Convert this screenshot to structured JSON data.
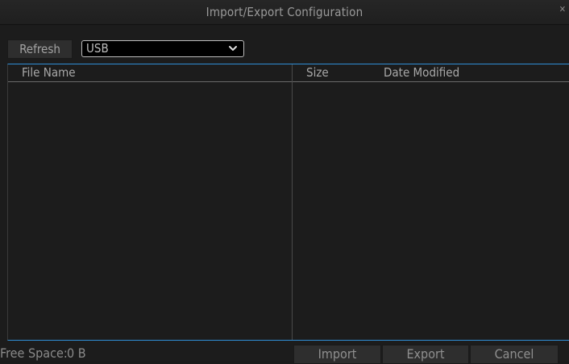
{
  "dialog": {
    "title": "Import/Export Configuration",
    "close_icon": "close-icon"
  },
  "toolbar": {
    "refresh_label": "Refresh",
    "device": {
      "selected": "USB",
      "icon": "chevron-down-icon"
    }
  },
  "table": {
    "columns": [
      "File Name",
      "Size",
      "Date Modified"
    ],
    "rows": []
  },
  "footer": {
    "free_space_label": "Free Space:",
    "free_space_value": "0 B",
    "import_label": "Import",
    "export_label": "Export",
    "cancel_label": "Cancel"
  },
  "colors": {
    "accent": "#2f8fd8",
    "background": "#1c1c1c"
  }
}
